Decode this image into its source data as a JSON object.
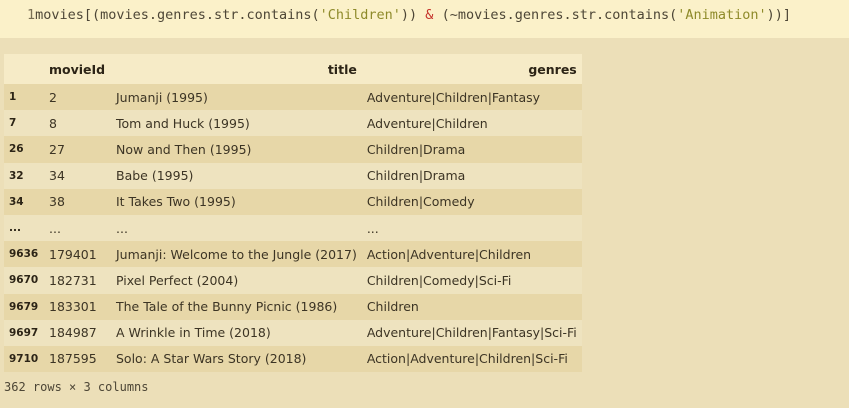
{
  "code": {
    "line_number": "1",
    "p1": "movies[(movies.genres.str.contains(",
    "s1": "'Children'",
    "p2": "))",
    "op": " & ",
    "p3": "(~movies.genres.str.contains(",
    "s2": "'Animation'",
    "p4": "))]"
  },
  "table": {
    "columns": [
      "",
      "movieId",
      "title",
      "genres"
    ],
    "rows": [
      [
        "1",
        "2",
        "Jumanji (1995)",
        "Adventure|Children|Fantasy"
      ],
      [
        "7",
        "8",
        "Tom and Huck (1995)",
        "Adventure|Children"
      ],
      [
        "26",
        "27",
        "Now and Then (1995)",
        "Children|Drama"
      ],
      [
        "32",
        "34",
        "Babe (1995)",
        "Children|Drama"
      ],
      [
        "34",
        "38",
        "It Takes Two (1995)",
        "Children|Comedy"
      ],
      [
        "...",
        "...",
        "...",
        "..."
      ],
      [
        "9636",
        "179401",
        "Jumanji: Welcome to the Jungle (2017)",
        "Action|Adventure|Children"
      ],
      [
        "9670",
        "182731",
        "Pixel Perfect (2004)",
        "Children|Comedy|Sci-Fi"
      ],
      [
        "9679",
        "183301",
        "The Tale of the Bunny Picnic (1986)",
        "Children"
      ],
      [
        "9697",
        "184987",
        "A Wrinkle in Time (2018)",
        "Adventure|Children|Fantasy|Sci-Fi"
      ],
      [
        "9710",
        "187595",
        "Solo: A Star Wars Story (2018)",
        "Action|Adventure|Children|Sci-Fi"
      ]
    ]
  },
  "shape_text": "362 rows × 3 columns"
}
